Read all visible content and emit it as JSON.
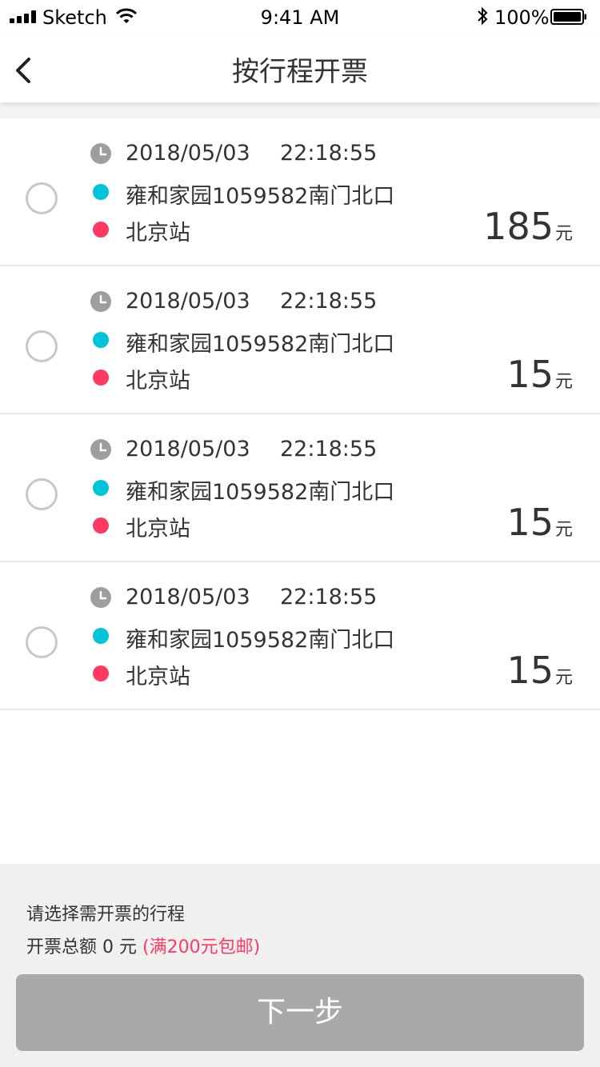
{
  "status_bar": {
    "carrier": "Sketch",
    "time": "9:41 AM",
    "battery": "100%"
  },
  "nav": {
    "title": "按行程开票"
  },
  "trips": [
    {
      "date": "2018/05/03",
      "time": "22:18:55",
      "origin": "雍和家园1059582南门北口",
      "destination": "北京站",
      "amount": "185",
      "unit": "元",
      "selected": false
    },
    {
      "date": "2018/05/03",
      "time": "22:18:55",
      "origin": "雍和家园1059582南门北口",
      "destination": "北京站",
      "amount": "15",
      "unit": "元",
      "selected": false
    },
    {
      "date": "2018/05/03",
      "time": "22:18:55",
      "origin": "雍和家园1059582南门北口",
      "destination": "北京站",
      "amount": "15",
      "unit": "元",
      "selected": false
    },
    {
      "date": "2018/05/03",
      "time": "22:18:55",
      "origin": "雍和家园1059582南门北口",
      "destination": "北京站",
      "amount": "15",
      "unit": "元",
      "selected": false
    }
  ],
  "footer": {
    "hint": "请选择需开票的行程",
    "total_label": "开票总额",
    "total_value": "0",
    "total_unit": "元",
    "promo": "(满200元包邮)",
    "next_label": "下一步"
  },
  "colors": {
    "origin_dot": "#00c4d8",
    "destination_dot": "#fe3a63",
    "promo_text": "#fe3a63",
    "button_disabled": "#a9a9a9"
  }
}
